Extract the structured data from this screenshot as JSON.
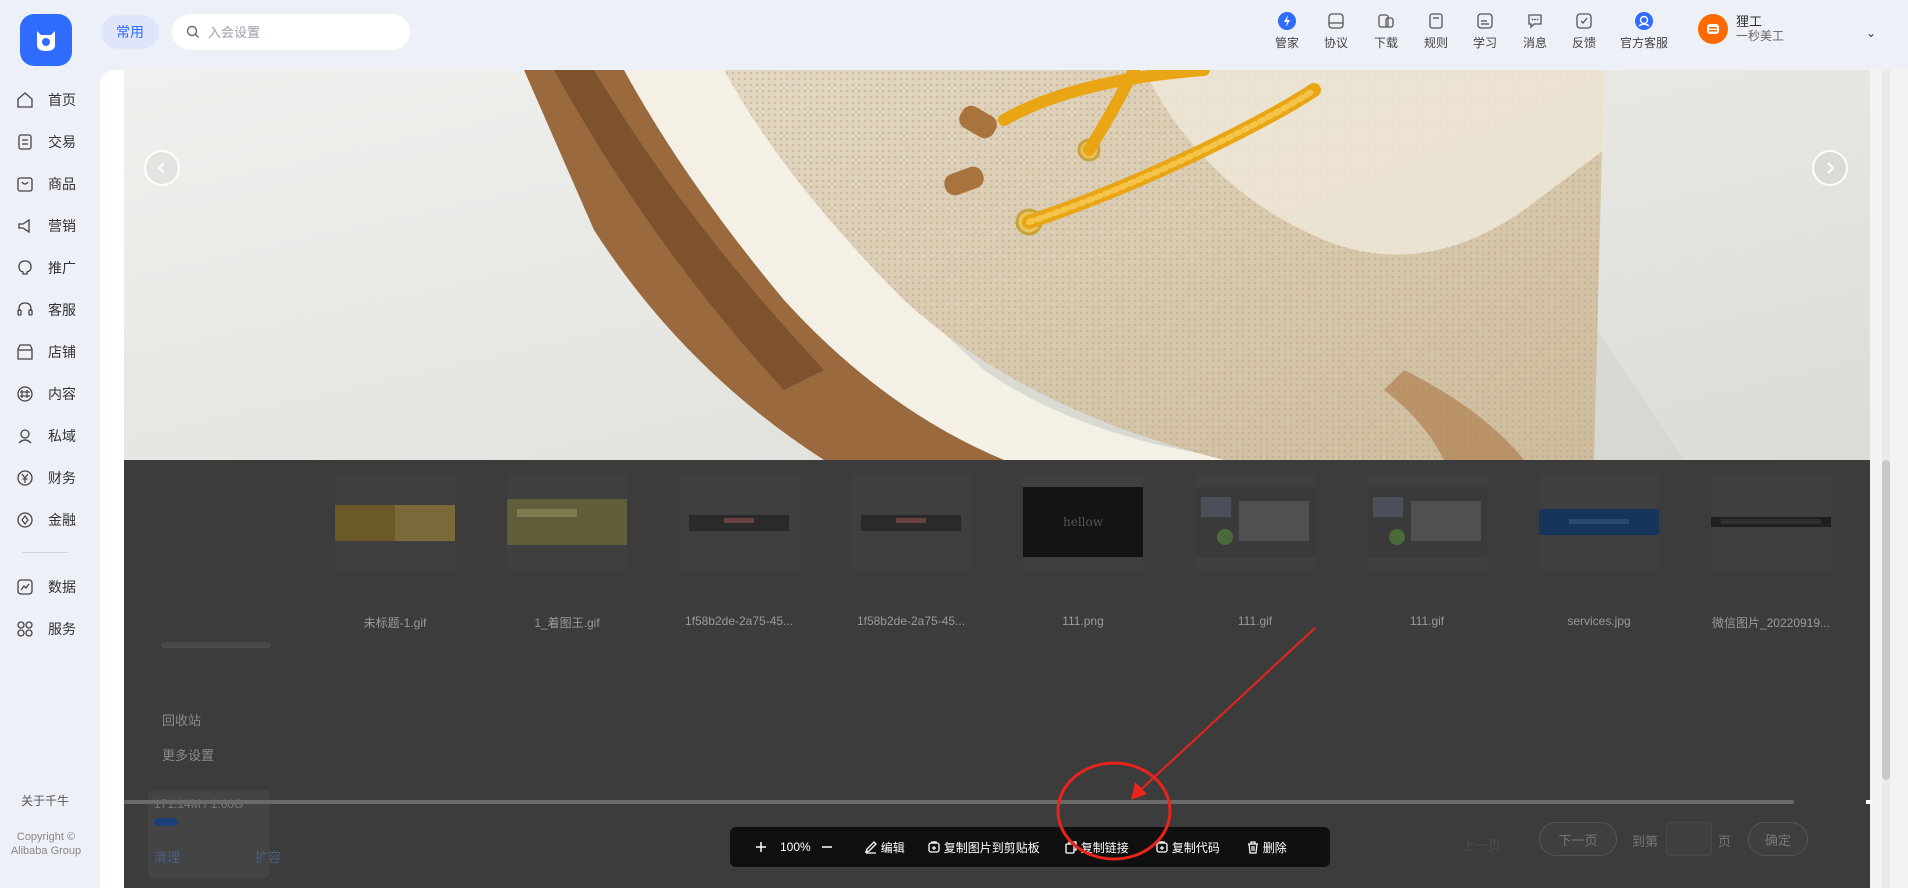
{
  "header": {
    "pill_label": "常用",
    "search_placeholder": "入会设置",
    "tools": [
      {
        "label": "管家",
        "icon": "butler-icon"
      },
      {
        "label": "协议",
        "icon": "agreement-icon"
      },
      {
        "label": "下载",
        "icon": "download-icon"
      },
      {
        "label": "规则",
        "icon": "rules-icon"
      },
      {
        "label": "学习",
        "icon": "learn-icon"
      },
      {
        "label": "消息",
        "icon": "message-icon"
      },
      {
        "label": "反馈",
        "icon": "feedback-icon"
      },
      {
        "label": "官方客服",
        "icon": "customer-service-icon"
      }
    ],
    "user_name": "狸工",
    "user_sub": "一秒美工"
  },
  "sidebar": {
    "items": [
      {
        "label": "首页",
        "icon": "home-icon"
      },
      {
        "label": "交易",
        "icon": "trade-icon"
      },
      {
        "label": "商品",
        "icon": "goods-icon"
      },
      {
        "label": "营销",
        "icon": "marketing-icon"
      },
      {
        "label": "推广",
        "icon": "promotion-icon"
      },
      {
        "label": "客服",
        "icon": "service-icon"
      },
      {
        "label": "店铺",
        "icon": "shop-icon"
      },
      {
        "label": "内容",
        "icon": "content-icon"
      },
      {
        "label": "私域",
        "icon": "private-domain-icon"
      },
      {
        "label": "财务",
        "icon": "finance-icon"
      },
      {
        "label": "金融",
        "icon": "banking-icon"
      },
      {
        "label": "数据",
        "icon": "data-icon"
      },
      {
        "label": "服务",
        "icon": "services-icon"
      }
    ],
    "about": "关于千牛",
    "copyright": "Copyright © Alibaba Group"
  },
  "gallery": {
    "files": [
      {
        "name": "未标题-1.gif"
      },
      {
        "name": "1_着图王.gif"
      },
      {
        "name": "1f58b2de-2a75-45..."
      },
      {
        "name": "1f58b2de-2a75-45..."
      },
      {
        "name": "111.png",
        "thumb_text": "hellow"
      },
      {
        "name": "111.gif"
      },
      {
        "name": "111.gif"
      },
      {
        "name": "services.jpg"
      },
      {
        "name": "微信图片_20220919..."
      }
    ],
    "recycle": "回收站",
    "more_settings": "更多设置",
    "storage": "171.14M / 1.00G",
    "storage_fraction": 0.167,
    "clean": "清理",
    "expand": "扩容",
    "pager": {
      "prev": "上一页",
      "next": "下一页",
      "goto": "到第",
      "page": "页",
      "ok": "确定"
    }
  },
  "viewer_toolbar": {
    "zoom": "100%",
    "edit": "编辑",
    "copy_image": "复制图片到剪贴板",
    "copy_link": "复制链接",
    "copy_code": "复制代码",
    "delete": "删除"
  },
  "colors": {
    "accent": "#2f6bff",
    "annotation": "#e8251c",
    "overlay": "#3c3c3c"
  }
}
